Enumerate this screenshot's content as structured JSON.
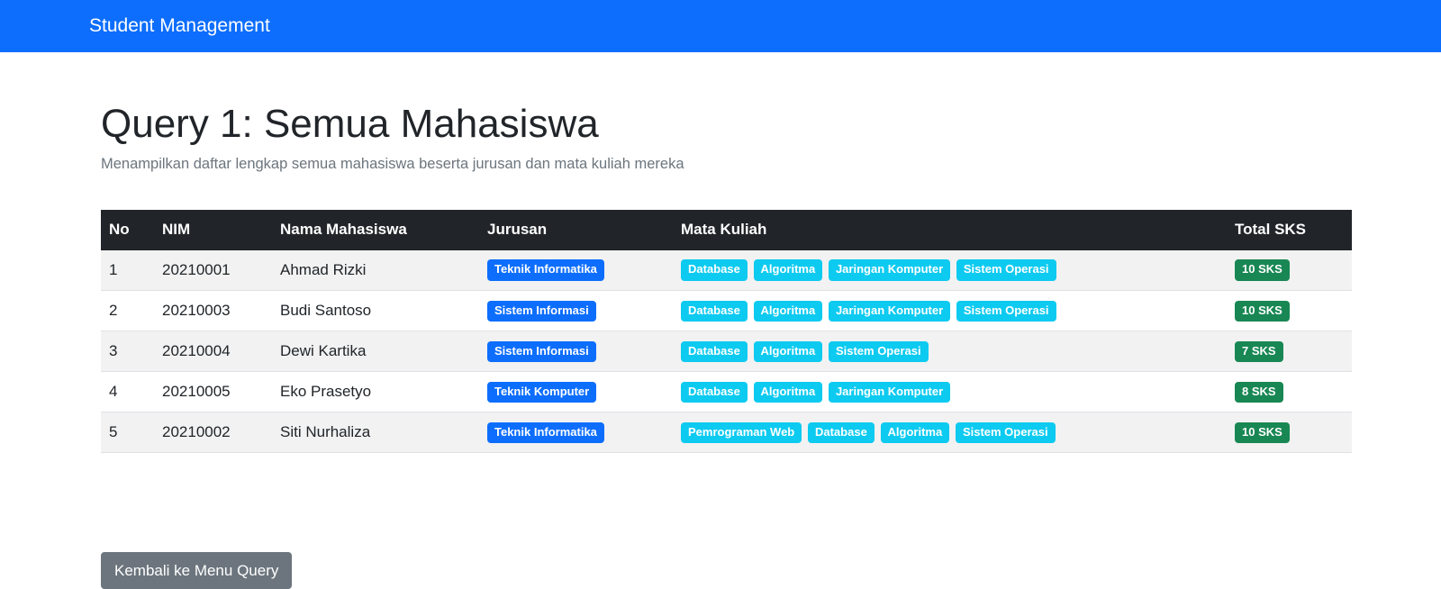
{
  "navbar": {
    "brand": "Student Management"
  },
  "page": {
    "title": "Query 1: Semua Mahasiswa",
    "subtitle": "Menampilkan daftar lengkap semua mahasiswa beserta jurusan dan mata kuliah mereka"
  },
  "table": {
    "columns": [
      "No",
      "NIM",
      "Nama Mahasiswa",
      "Jurusan",
      "Mata Kuliah",
      "Total SKS"
    ],
    "rows": [
      {
        "no": "1",
        "nim": "20210001",
        "nama": "Ahmad Rizki",
        "jurusan": "Teknik Informatika",
        "mata_kuliah": [
          "Database",
          "Algoritma",
          "Jaringan Komputer",
          "Sistem Operasi"
        ],
        "total_sks": "10 SKS"
      },
      {
        "no": "2",
        "nim": "20210003",
        "nama": "Budi Santoso",
        "jurusan": "Sistem Informasi",
        "mata_kuliah": [
          "Database",
          "Algoritma",
          "Jaringan Komputer",
          "Sistem Operasi"
        ],
        "total_sks": "10 SKS"
      },
      {
        "no": "3",
        "nim": "20210004",
        "nama": "Dewi Kartika",
        "jurusan": "Sistem Informasi",
        "mata_kuliah": [
          "Database",
          "Algoritma",
          "Sistem Operasi"
        ],
        "total_sks": "7 SKS"
      },
      {
        "no": "4",
        "nim": "20210005",
        "nama": "Eko Prasetyo",
        "jurusan": "Teknik Komputer",
        "mata_kuliah": [
          "Database",
          "Algoritma",
          "Jaringan Komputer"
        ],
        "total_sks": "8 SKS"
      },
      {
        "no": "5",
        "nim": "20210002",
        "nama": "Siti Nurhaliza",
        "jurusan": "Teknik Informatika",
        "mata_kuliah": [
          "Pemrograman Web",
          "Database",
          "Algoritma",
          "Sistem Operasi"
        ],
        "total_sks": "10 SKS"
      }
    ]
  },
  "actions": {
    "back_label": "Kembali ke Menu Query"
  },
  "colors": {
    "navbar": "#0d6efd",
    "table_header": "#212529",
    "badge_jurusan": "#0d6efd",
    "badge_mata_kuliah": "#0dcaf0",
    "badge_sks": "#198754",
    "button_secondary": "#6c757d"
  }
}
